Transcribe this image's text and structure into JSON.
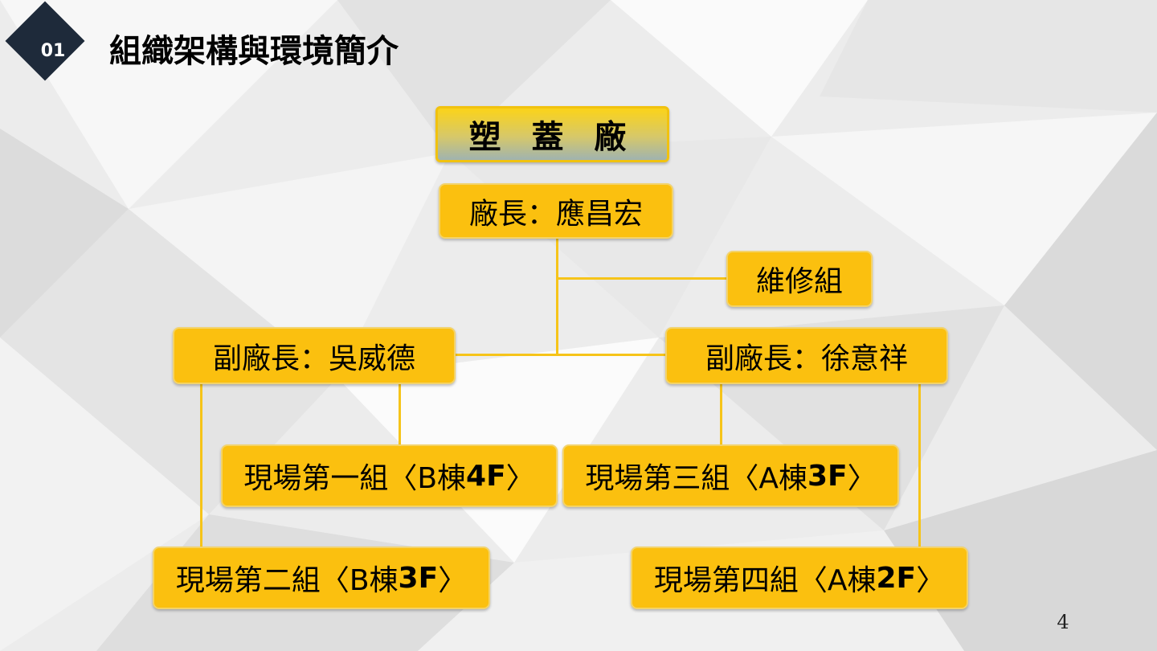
{
  "header": {
    "section_number": "01",
    "title": "組織架構與環境簡介"
  },
  "org_chart": {
    "root": "塑 蓋 廠",
    "director": "廠長：應昌宏",
    "maintenance": "維修組",
    "deputy_left": "副廠長：吳威德",
    "deputy_right": "副廠長：徐意祥",
    "group1": {
      "name": "現場第一組〈B棟",
      "floor": "4F",
      "end": "〉"
    },
    "group2": {
      "name": "現場第二組〈B棟",
      "floor": "3F",
      "end": "〉"
    },
    "group3": {
      "name": "現場第三組〈A棟",
      "floor": "3F",
      "end": "〉"
    },
    "group4": {
      "name": "現場第四組〈A棟",
      "floor": "2F",
      "end": "〉"
    }
  },
  "colors": {
    "box_fill": "#fbc00f",
    "connector": "#f6c419",
    "badge": "#1e2a3a"
  },
  "page_number": "4"
}
